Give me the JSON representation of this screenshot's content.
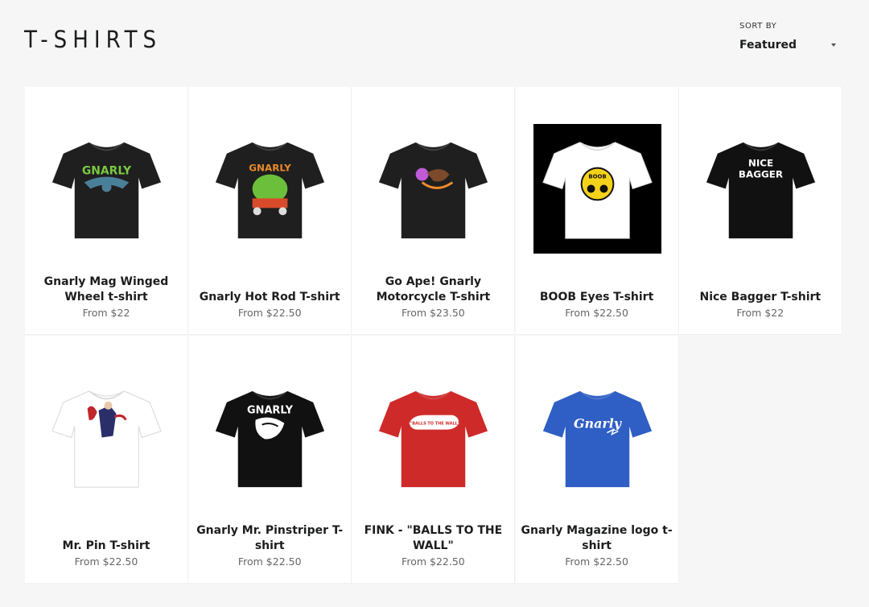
{
  "page": {
    "title": "T-SHIRTS"
  },
  "sort": {
    "label": "SORT BY",
    "value": "Featured"
  },
  "products": [
    {
      "title": "Gnarly Mag Winged Wheel t-shirt",
      "price": "From $22",
      "shirt_color": "#1f1f1f",
      "graphic": "GNARLY",
      "graphic_color": "#7ac943"
    },
    {
      "title": "Gnarly Hot Rod T-shirt",
      "price": "From $22.50",
      "shirt_color": "#1f1f1f",
      "graphic": "GNARLY",
      "graphic_color": "#e88a2a"
    },
    {
      "title": "Go Ape! Gnarly Motorcycle T-shirt",
      "price": "From $23.50",
      "shirt_color": "#1f1f1f",
      "graphic": "",
      "graphic_color": "#c05ad6"
    },
    {
      "title": "BOOB Eyes T-shirt",
      "price": "From $22.50",
      "shirt_color": "#ffffff",
      "graphic": "BOOB",
      "graphic_color": "#f5d21a",
      "background": "#000000"
    },
    {
      "title": "Nice Bagger T-shirt",
      "price": "From $22",
      "shirt_color": "#111111",
      "graphic": "NICE BAGGER",
      "graphic_color": "#ffffff"
    },
    {
      "title": "Mr. Pin T-shirt",
      "price": "From $22.50",
      "shirt_color": "#ffffff",
      "graphic": "",
      "graphic_color": "#c0262c"
    },
    {
      "title": "Gnarly Mr. Pinstriper T-shirt",
      "price": "From $22.50",
      "shirt_color": "#111111",
      "graphic": "GNARLY",
      "graphic_color": "#ffffff"
    },
    {
      "title": "FINK - \"BALLS TO THE WALL\"",
      "price": "From $22.50",
      "shirt_color": "#cf2a2a",
      "graphic": "\"BALLS TO THE WALL\"",
      "graphic_color": "#ffffff"
    },
    {
      "title": "Gnarly Magazine logo t-shirt",
      "price": "From $22.50",
      "shirt_color": "#2f5fc4",
      "graphic": "Gnarly",
      "graphic_color": "#ffffff"
    }
  ]
}
